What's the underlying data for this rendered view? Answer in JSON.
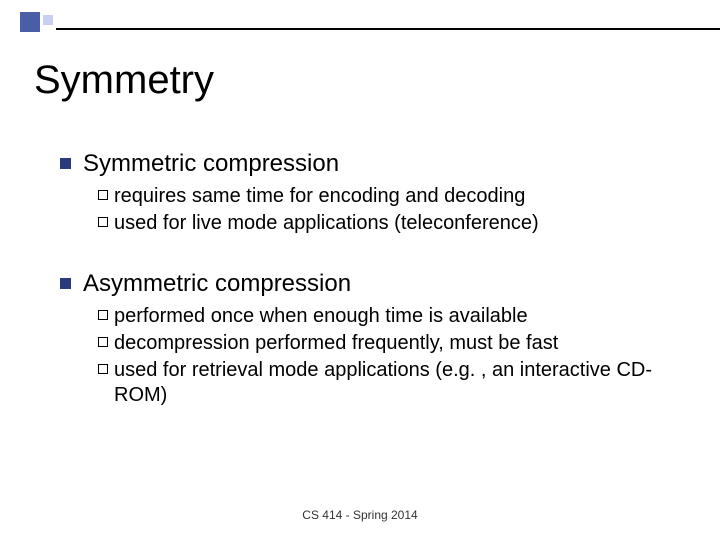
{
  "title": "Symmetry",
  "sections": [
    {
      "heading": "Symmetric compression",
      "items": [
        "requires same time for encoding and decoding",
        "used for live mode applications (teleconference)"
      ]
    },
    {
      "heading": "Asymmetric compression",
      "items": [
        "performed once when enough time is available",
        "decompression performed frequently, must be fast",
        "used for retrieval mode applications (e.g. , an interactive CD-ROM)"
      ]
    }
  ],
  "footer": "CS 414 - Spring 2014"
}
